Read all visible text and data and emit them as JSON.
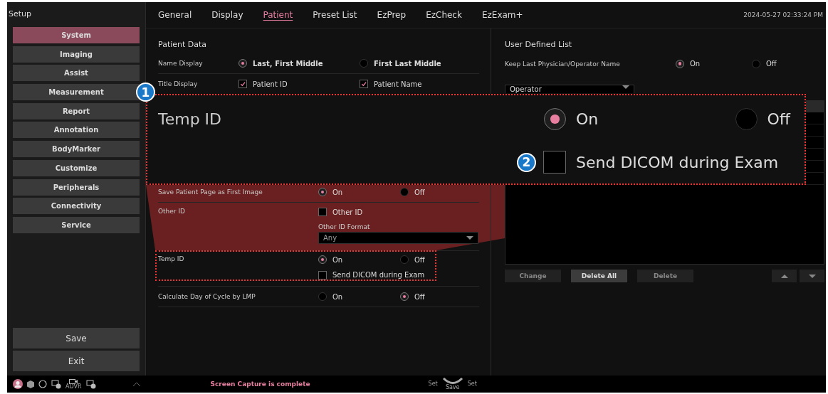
{
  "sidebar": {
    "title": "Setup",
    "items": [
      {
        "label": "System",
        "selected": true
      },
      {
        "label": "Imaging",
        "selected": false
      },
      {
        "label": "Assist",
        "selected": false
      },
      {
        "label": "Measurement",
        "selected": false
      },
      {
        "label": "Report",
        "selected": false
      },
      {
        "label": "Annotation",
        "selected": false
      },
      {
        "label": "BodyMarker",
        "selected": false
      },
      {
        "label": "Customize",
        "selected": false
      },
      {
        "label": "Peripherals",
        "selected": false
      },
      {
        "label": "Connectivity",
        "selected": false
      },
      {
        "label": "Service",
        "selected": false
      }
    ],
    "actions": [
      "Save",
      "Exit"
    ]
  },
  "tabs": [
    {
      "label": "General",
      "selected": false
    },
    {
      "label": "Display",
      "selected": false
    },
    {
      "label": "Patient",
      "selected": true
    },
    {
      "label": "Preset List",
      "selected": false
    },
    {
      "label": "EzPrep",
      "selected": false
    },
    {
      "label": "EzCheck",
      "selected": false
    },
    {
      "label": "EzExam+",
      "selected": false
    }
  ],
  "datetime": "2024-05-27 02:33:24 PM",
  "patient_data": {
    "title": "Patient Data",
    "upper_rows": [
      {
        "kind": "radio",
        "label": "Name Display",
        "options": [
          {
            "label": "Last, First Middle",
            "selected": true
          },
          {
            "label": "First Last Middle",
            "selected": false
          }
        ]
      },
      {
        "kind": "checkbox",
        "label": "Title Display",
        "options": [
          {
            "label": "Patient ID",
            "checked": true
          },
          {
            "label": "Patient Name",
            "checked": true
          }
        ]
      }
    ],
    "lower_rows": [
      {
        "kind": "radio",
        "label": "Save Patient Page as First Image",
        "options": [
          {
            "label": "On",
            "selected": true
          },
          {
            "label": "Off",
            "selected": false
          }
        ]
      },
      {
        "kind": "other_id",
        "label": "Other ID",
        "checkbox": {
          "label": "Other ID",
          "checked": false
        },
        "format_label": "Other ID Format",
        "format_value": "Any"
      },
      {
        "kind": "radio_check",
        "label": "Temp ID",
        "options": [
          {
            "label": "On",
            "selected": true
          },
          {
            "label": "Off",
            "selected": false
          }
        ],
        "checkbox": {
          "label": "Send DICOM during Exam",
          "checked": false
        }
      },
      {
        "kind": "radio",
        "label": "Calculate Day of Cycle by LMP",
        "options": [
          {
            "label": "On",
            "selected": false
          },
          {
            "label": "Off",
            "selected": true
          }
        ]
      }
    ]
  },
  "user_defined_list": {
    "title": "User Defined List",
    "keep_last": {
      "label": "Keep Last Physician/Operator Name",
      "options": [
        {
          "label": "On",
          "selected": true
        },
        {
          "label": "Off",
          "selected": false
        }
      ]
    },
    "dropdown": "Operator",
    "buttons": [
      {
        "label": "Change",
        "disabled": true
      },
      {
        "label": "Delete All",
        "disabled": false
      },
      {
        "label": "Delete",
        "disabled": true
      }
    ]
  },
  "callout": {
    "badge": "1",
    "title": "Temp ID",
    "options": [
      {
        "label": "On",
        "selected": true
      },
      {
        "label": "Off",
        "selected": false
      }
    ],
    "badge_2": "2",
    "checkbox": {
      "label": "Send DICOM during Exam",
      "checked": false
    }
  },
  "status_bar": {
    "advr": "ADVR",
    "message": "Screen Capture is complete",
    "dial_left": "Set",
    "dial_right": "Set",
    "dial_bottom": "Save"
  }
}
